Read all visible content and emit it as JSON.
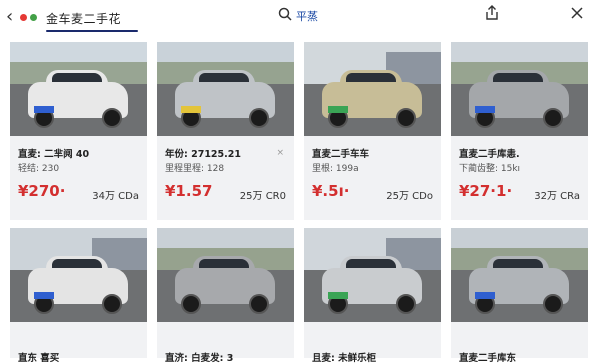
{
  "header": {
    "title": "金车麦二手花",
    "search_label": "平蒸"
  },
  "cards": [
    {
      "line1": "直麦: 二芈阋 40",
      "line2": "轻结: 230",
      "price": "¥270·",
      "sub": "34万 CDa",
      "color": "#e8e8e8",
      "x_mark": ""
    },
    {
      "line1": "年份: 27125.21",
      "line2": "里程里程: 128",
      "price": "¥1.57",
      "sub": "25万 CR0",
      "color": "#bfc3c7",
      "x_mark": "×"
    },
    {
      "line1": "直麦二手车车",
      "line2": "里根: 199a",
      "price": "¥.5ı·",
      "sub": "25万 CDo",
      "color": "#c7bd97",
      "x_mark": ""
    },
    {
      "line1": "直麦二手库恚.",
      "line2": "下蔺齿整: 15kı",
      "price": "¥27·1·",
      "sub": "32万 CRa",
      "color": "#a4a7aa",
      "x_mark": ""
    },
    {
      "line1": "直东 喜买 ",
      "color": "#e4e4e4"
    },
    {
      "line1": "直济: 白麦发: 3",
      "color": "#a7a9ac"
    },
    {
      "line1": "且麦: 未鲜乐柜",
      "color": "#c9cccf"
    },
    {
      "line1": "直麦二手库东",
      "color": "#b0b4b8"
    }
  ]
}
